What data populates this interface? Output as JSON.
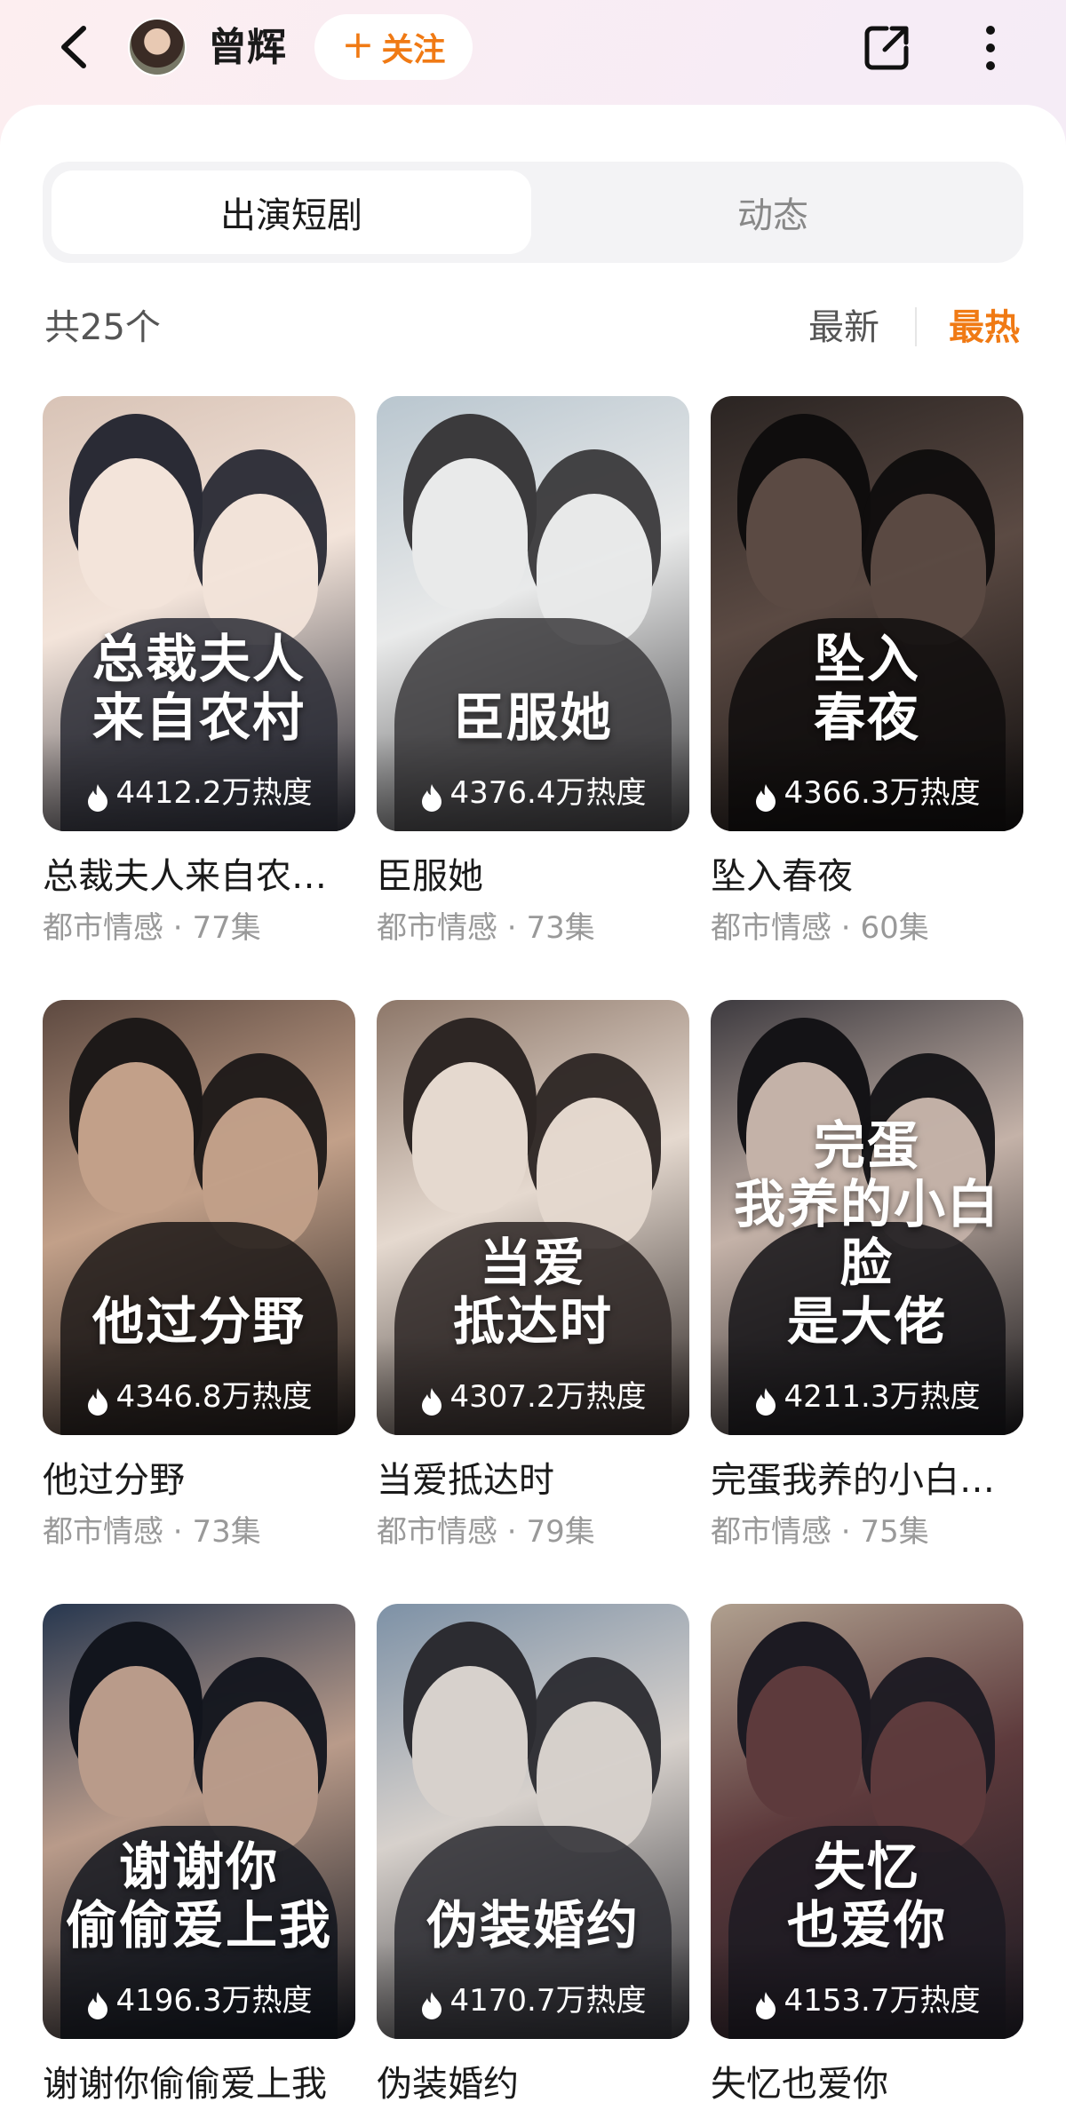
{
  "header": {
    "username": "曾辉",
    "follow_label": "关注",
    "follow_icon": "plus-icon"
  },
  "tabs": [
    {
      "label": "出演短剧",
      "active": true
    },
    {
      "label": "动态",
      "active": false
    }
  ],
  "list": {
    "count_text": "共25个",
    "sort_options": [
      {
        "label": "最新",
        "active": false
      },
      {
        "label": "最热",
        "active": true
      }
    ]
  },
  "colors": {
    "accent": "#f07a14",
    "panel": "#ffffff",
    "muted_text": "#999999"
  },
  "dramas": [
    {
      "title": "总裁夫人来自农…",
      "genre": "都市情感",
      "episodes": "77集",
      "heat": "4412.2万热度",
      "poster_text": [
        "总裁夫人",
        "来自农村"
      ],
      "tones": [
        "#d8c3b6",
        "#f3e4da",
        "#2a2b35"
      ]
    },
    {
      "title": "臣服她",
      "genre": "都市情感",
      "episodes": "73集",
      "heat": "4376.4万热度",
      "poster_text": [
        "臣服她"
      ],
      "tones": [
        "#b9c6cf",
        "#e9eaea",
        "#3b3a3c"
      ]
    },
    {
      "title": "坠入春夜",
      "genre": "都市情感",
      "episodes": "60集",
      "heat": "4366.3万热度",
      "poster_text": [
        "坠入",
        "春夜"
      ],
      "tones": [
        "#2a2422",
        "#5b4a43",
        "#0f0d0d"
      ]
    },
    {
      "title": "他过分野",
      "genre": "都市情感",
      "episodes": "73集",
      "heat": "4346.8万热度",
      "poster_text": [
        "他过分野"
      ],
      "tones": [
        "#5d4940",
        "#c2a089",
        "#1d1918"
      ]
    },
    {
      "title": "当爱抵达时",
      "genre": "都市情感",
      "episodes": "79集",
      "heat": "4307.2万热度",
      "poster_text": [
        "当爱",
        "抵达时"
      ],
      "tones": [
        "#8d7769",
        "#e5d9cf",
        "#2d2624"
      ]
    },
    {
      "title": "完蛋我养的小白…",
      "genre": "都市情感",
      "episodes": "75集",
      "heat": "4211.3万热度",
      "poster_text": [
        "完蛋",
        "我养的小白脸",
        "是大佬"
      ],
      "tones": [
        "#3d3a3f",
        "#c4b2a8",
        "#141316"
      ]
    },
    {
      "title": "谢谢你偷偷爱上我",
      "genre": "",
      "episodes": "",
      "heat": "4196.3万热度",
      "poster_text": [
        "谢谢你",
        "偷偷爱上我"
      ],
      "tones": [
        "#27374f",
        "#b99b8a",
        "#12151d"
      ]
    },
    {
      "title": "伪装婚约",
      "genre": "",
      "episodes": "",
      "heat": "4170.7万热度",
      "poster_text": [
        "伪装婚约"
      ],
      "tones": [
        "#7d91a6",
        "#d7d1cc",
        "#2c2c31"
      ]
    },
    {
      "title": "失忆也爱你",
      "genre": "",
      "episodes": "",
      "heat": "4153.7万热度",
      "poster_text": [
        "失忆",
        "也爱你"
      ],
      "tones": [
        "#b0a08f",
        "#5d3a3c",
        "#1c1a22"
      ]
    }
  ]
}
